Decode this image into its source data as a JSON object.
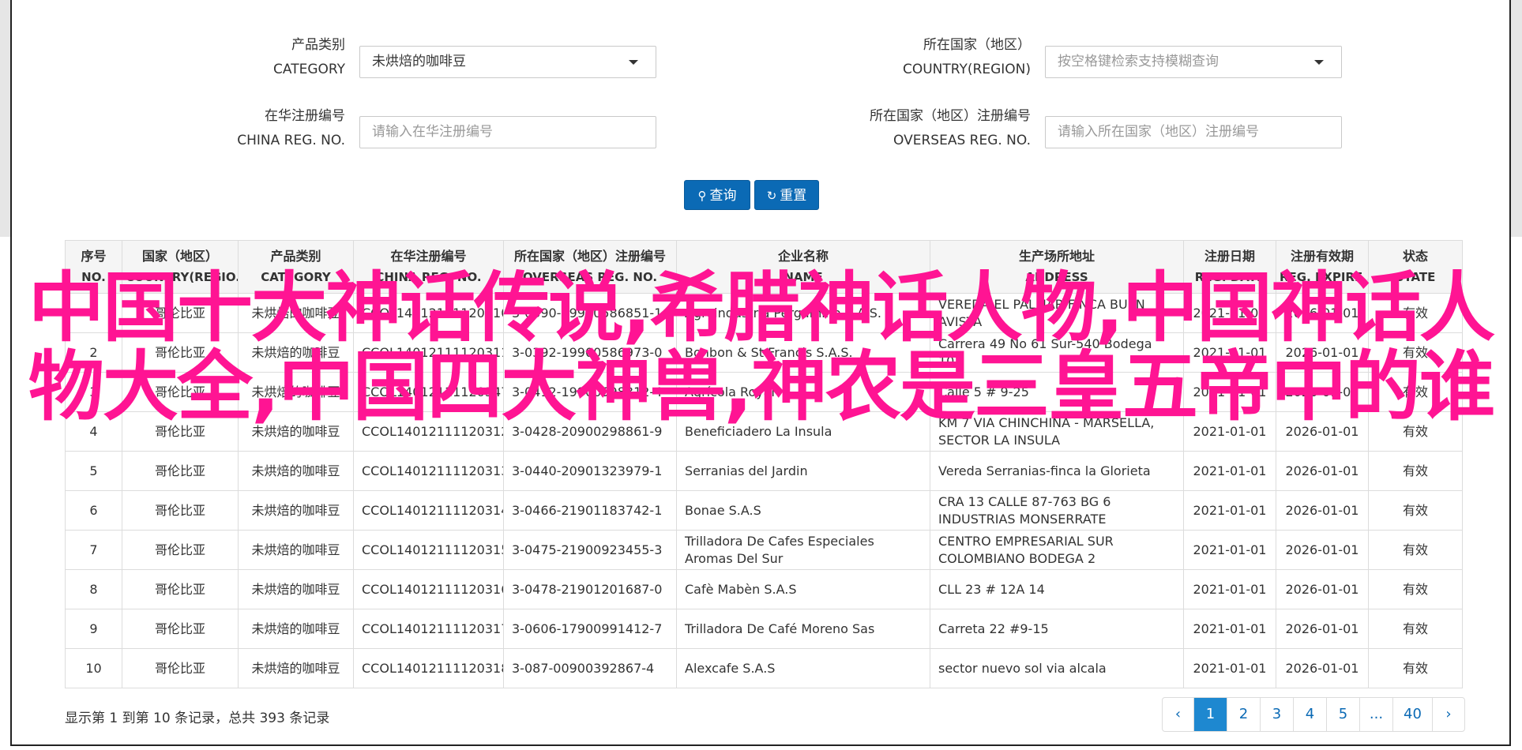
{
  "search": {
    "category_label_cn": "产品类别",
    "category_label_en": "CATEGORY",
    "category_value": "未烘焙的咖啡豆",
    "country_label_cn": "所在国家（地区）",
    "country_label_en": "COUNTRY(REGION)",
    "country_placeholder": "按空格键检索支持模糊查询",
    "china_reg_label_cn": "在华注册编号",
    "china_reg_label_en": "CHINA REG. NO.",
    "china_reg_placeholder": "请输入在华注册编号",
    "overseas_reg_label_cn": "所在国家（地区）注册编号",
    "overseas_reg_label_en": "OVERSEAS REG. NO.",
    "overseas_reg_placeholder": "请输入所在国家（地区）注册编号",
    "query_button": "查询",
    "reset_button": "重置"
  },
  "table": {
    "headers": [
      {
        "cn": "序号",
        "en": "NO."
      },
      {
        "cn": "国家（地区）",
        "en": "COUNTRY(REGIO..."
      },
      {
        "cn": "产品类别",
        "en": "CATEGORY"
      },
      {
        "cn": "在华注册编号",
        "en": "CHINA REG. NO."
      },
      {
        "cn": "所在国家（地区）注册编号",
        "en": "OVERSEAS REG. NO."
      },
      {
        "cn": "企业名称",
        "en": "NAME"
      },
      {
        "cn": "生产场所地址",
        "en": "ADDRESS"
      },
      {
        "cn": "注册日期",
        "en": "REG. DATE"
      },
      {
        "cn": "注册有效期",
        "en": "REG. EXPIRE ..."
      },
      {
        "cn": "状态",
        "en": "STATE"
      }
    ],
    "rows": [
      [
        "1",
        "哥伦比亚",
        "未烘焙的咖啡豆",
        "CCOL14012111120310",
        "3-0390-19900586851-1",
        "Agroindustria Pergamino S.A.S.",
        "VEREDA EL PALMAR FINCA BUEN AVISTA",
        "2021-01-01",
        "2026-01-01",
        "有效"
      ],
      [
        "2",
        "哥伦比亚",
        "未烘焙的咖啡豆",
        "CCOL14012111120311",
        "3-0392-19900586973-0",
        "Bonbon & St Francis S.A.S.",
        "Carrera 49 No 61 Sur-540 Bodega 101",
        "2021-01-01",
        "2026-01-01",
        "有效"
      ],
      [
        "3",
        "哥伦比亚",
        "未烘焙的咖啡豆",
        "CCOL14012111120347",
        "3-0412-19900598312-4",
        "Agrícola Royal",
        "Calle 5 # 9-25",
        "2021-01-01",
        "2026-01-01",
        "有效"
      ],
      [
        "4",
        "哥伦比亚",
        "未烘焙的咖啡豆",
        "CCOL14012111120312",
        "3-0428-20900298861-9",
        "Beneficiadero La Insula",
        "KM 7 VIA CHINCHINA - MARSELLA, SECTOR LA INSULA",
        "2021-01-01",
        "2026-01-01",
        "有效"
      ],
      [
        "5",
        "哥伦比亚",
        "未烘焙的咖啡豆",
        "CCOL14012111120313",
        "3-0440-20901323979-1",
        "Serranias del Jardin",
        "Vereda Serranias-finca la Glorieta",
        "2021-01-01",
        "2026-01-01",
        "有效"
      ],
      [
        "6",
        "哥伦比亚",
        "未烘焙的咖啡豆",
        "CCOL14012111120314",
        "3-0466-21901183742-1",
        "Bonae S.A.S",
        "CRA 13 CALLE 87-763 BG 6 INDUSTRIAS MONSERRATE",
        "2021-01-01",
        "2026-01-01",
        "有效"
      ],
      [
        "7",
        "哥伦比亚",
        "未烘焙的咖啡豆",
        "CCOL14012111120315",
        "3-0475-21900923455-3",
        "Trilladora De Cafes Especiales Aromas Del Sur",
        "CENTRO EMPRESARIAL SUR COLOMBIANO BODEGA 2",
        "2021-01-01",
        "2026-01-01",
        "有效"
      ],
      [
        "8",
        "哥伦比亚",
        "未烘焙的咖啡豆",
        "CCOL14012111120316",
        "3-0478-21901201687-0",
        "Cafè Mabèn S.A.S",
        "CLL 23 # 12A 14",
        "2021-01-01",
        "2026-01-01",
        "有效"
      ],
      [
        "9",
        "哥伦比亚",
        "未烘焙的咖啡豆",
        "CCOL14012111120317",
        "3-0606-17900991412-7",
        "Trilladora De Café Moreno Sas",
        "Carreta 22 #9-15",
        "2021-01-01",
        "2026-01-01",
        "有效"
      ],
      [
        "10",
        "哥伦比亚",
        "未烘焙的咖啡豆",
        "CCOL14012111120318",
        "3-087-00900392867-4",
        "Alexcafe S.A.S",
        "sector nuevo sol via alcala",
        "2021-01-01",
        "2026-01-01",
        "有效"
      ]
    ]
  },
  "footer": {
    "summary": "显示第 1 到第 10 条记录，总共 393 条记录",
    "pages": [
      "‹",
      "1",
      "2",
      "3",
      "4",
      "5",
      "...",
      "40",
      "›"
    ],
    "active_page": "1"
  },
  "overlay": {
    "text": "中国十大神话传说,希腊神话人物,中国神话人物大全,中国四大神兽,神农是三皇五帝中的谁"
  },
  "colors": {
    "primary": "#0b6ab5",
    "active_page": "#1e88d0",
    "overlay": "#ff1493"
  }
}
